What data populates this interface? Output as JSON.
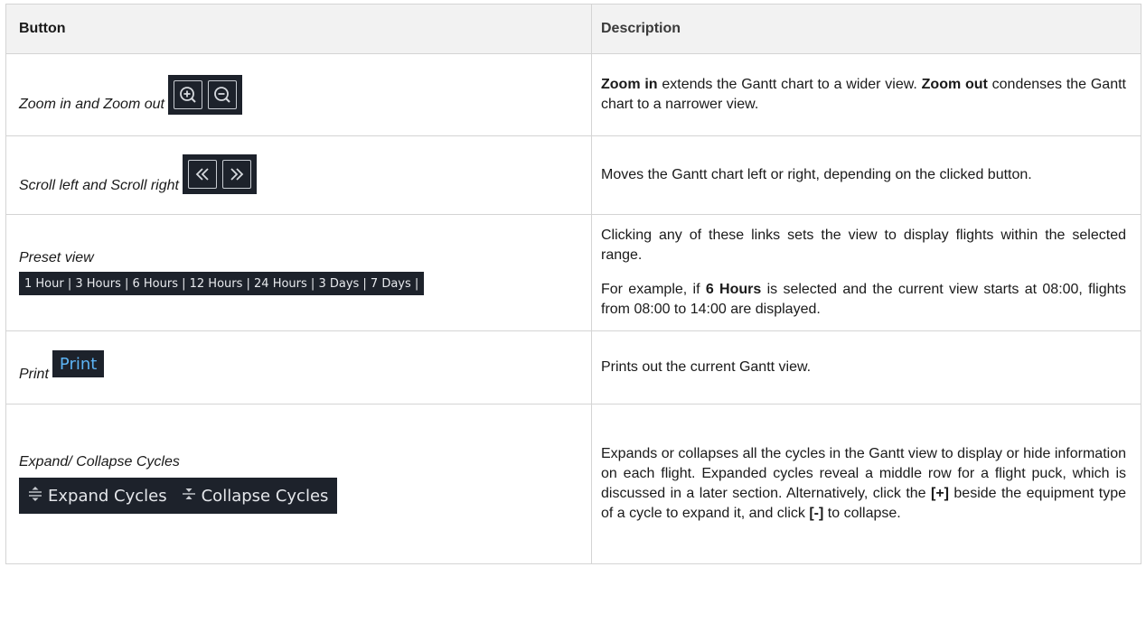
{
  "table": {
    "headers": {
      "button": "Button",
      "description": "Description"
    },
    "rows": [
      {
        "button_label": "Zoom in and Zoom out",
        "icons": [
          "zoom-in-icon",
          "zoom-out-icon"
        ],
        "description": {
          "b1": "Zoom in",
          "t1": " extends the Gantt chart to a wider view. ",
          "b2": "Zoom out",
          "t2": " condenses the Gantt chart to a narrower view."
        }
      },
      {
        "button_label": "Scroll left and Scroll right",
        "icons": [
          "scroll-left-icon",
          "scroll-right-icon"
        ],
        "description": {
          "t1": "Moves the Gantt chart left or right, depending on the clicked button."
        }
      },
      {
        "button_label": "Preset view",
        "preset_bar": "1 Hour | 3 Hours | 6 Hours | 12 Hours | 24 Hours | 3 Days | 7 Days |",
        "description": {
          "p1": "Clicking any of these links sets the view to display flights within the selected range.",
          "p2_t1": "For example, if ",
          "p2_b1": "6 Hours",
          "p2_t2": " is selected and the current view starts at 08:00, flights from 08:00 to 14:00 are displayed."
        }
      },
      {
        "button_label": "Print",
        "print_button": "Print",
        "description": {
          "t1": "Prints out the current Gantt view."
        }
      },
      {
        "button_label": "Expand/ Collapse Cycles",
        "expand_button": "Expand Cycles",
        "collapse_button": "Collapse Cycles",
        "icons": [
          "expand-icon",
          "collapse-icon"
        ],
        "description": {
          "t1": "Expands or collapses all the cycles in the Gantt view to display or hide information on each flight. Expanded cycles reveal a middle row for a flight puck, which is discussed in a later section. Alternatively,  click the ",
          "b1": "[+]",
          "t2": " beside the equipment type of a cycle to expand it, and click ",
          "b2": "[-]",
          "t3": " to collapse."
        }
      }
    ]
  },
  "colors": {
    "dark_toolbar": "#1d222b",
    "print_text": "#5cb3f4",
    "header_bg": "#f2f2f2",
    "border": "#d4d4d4"
  }
}
